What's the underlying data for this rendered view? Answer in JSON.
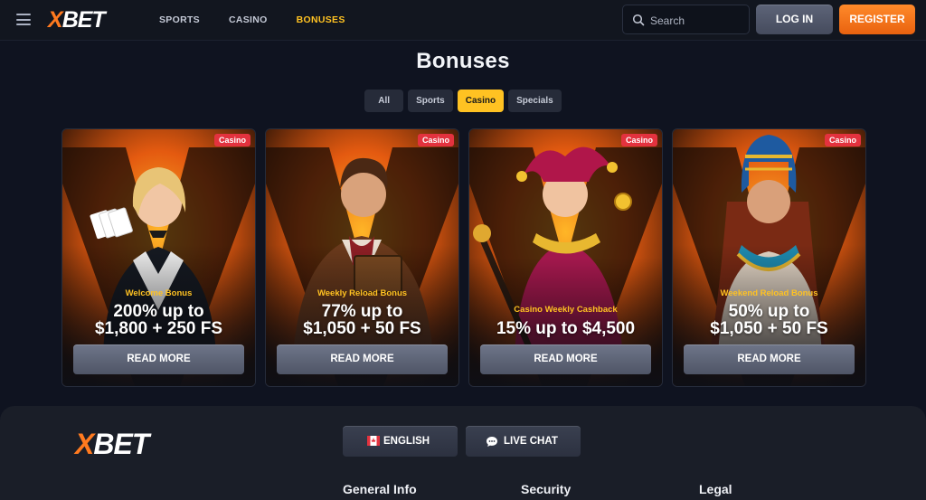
{
  "header": {
    "logo": {
      "x": "X",
      "rest": "BET"
    },
    "nav": [
      {
        "label": "SPORTS",
        "active": false
      },
      {
        "label": "CASINO",
        "active": false
      },
      {
        "label": "BONUSES",
        "active": true
      }
    ],
    "search_placeholder": "Search",
    "login_label": "LOG IN",
    "register_label": "REGISTER"
  },
  "main": {
    "title": "Bonuses",
    "filters": [
      {
        "label": "All",
        "active": false
      },
      {
        "label": "Sports",
        "active": false
      },
      {
        "label": "Casino",
        "active": true
      },
      {
        "label": "Specials",
        "active": false
      }
    ],
    "cards": [
      {
        "badge": "Casino",
        "subtitle": "Welcome Bonus",
        "amount_line1": "200% up to",
        "amount_line2": "$1,800 + 250 FS",
        "button": "READ MORE",
        "character": "dealer-woman"
      },
      {
        "badge": "Casino",
        "subtitle": "Weekly Reload Bonus",
        "amount_line1": "77% up to",
        "amount_line2": "$1,050 + 50 FS",
        "button": "READ MORE",
        "character": "adventurer-man"
      },
      {
        "badge": "Casino",
        "subtitle": "Casino Weekly Cashback",
        "amount_line1": "15% up to $4,500",
        "amount_line2": "",
        "button": "READ MORE",
        "character": "jester-woman"
      },
      {
        "badge": "Casino",
        "subtitle": "Weekend Reload Bonus",
        "amount_line1": "50% up to",
        "amount_line2": "$1,050 + 50 FS",
        "button": "READ MORE",
        "character": "pharaoh-queen"
      }
    ]
  },
  "footer": {
    "logo": {
      "x": "X",
      "rest": "BET"
    },
    "language_label": "ENGLISH",
    "live_chat_label": "LIVE CHAT",
    "columns": [
      "General Info",
      "Security",
      "Legal"
    ]
  },
  "colors": {
    "accent": "#ffc222",
    "register": "#f27a1f",
    "badge": "#e3323e",
    "background": "#0f1320"
  },
  "icons": [
    "hamburger-menu-icon",
    "search-icon",
    "canada-flag-icon",
    "chat-bubble-icon"
  ]
}
